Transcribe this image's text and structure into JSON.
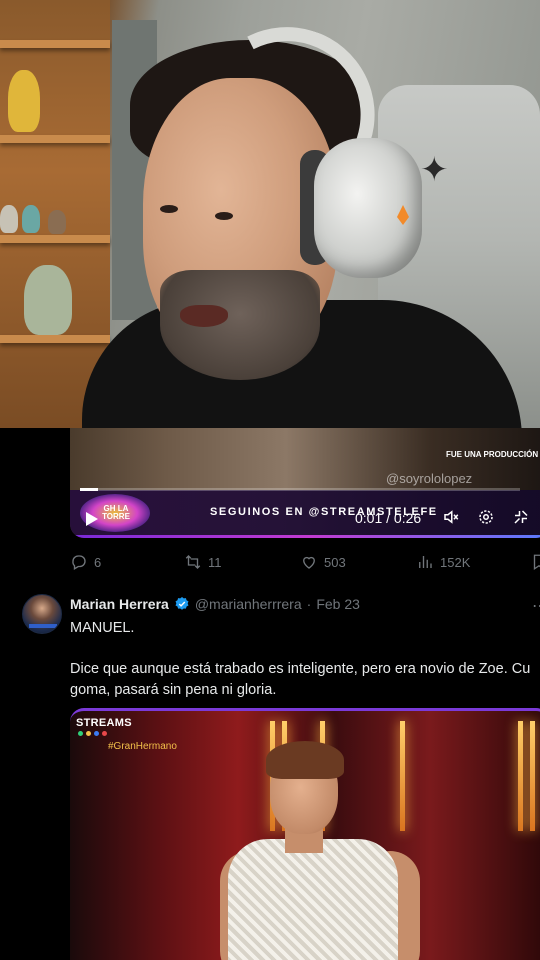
{
  "webcam": {
    "description_icon": "person-webcam-feed"
  },
  "top_video": {
    "fue_text": "FUE UNA PRODUCCIÓN",
    "watermark_handle": "@soyrololopez",
    "show_logo_text": "GH LA TORRE",
    "promo_text": "SEGUINOS EN @STREAMSTELEFE",
    "time": "0:01 / 0:26",
    "progress": 0.04,
    "controls": [
      "mute-icon",
      "settings-icon",
      "fullscreen-exit-icon"
    ]
  },
  "actions": {
    "replies": "6",
    "reposts": "11",
    "likes": "503",
    "views": "152K"
  },
  "tweet": {
    "display_name": "Marian Herrera",
    "handle": "@marianherrrera",
    "separator": "·",
    "date": "Feb 23",
    "line1": "MANUEL.",
    "line2": "Dice que aunque está trabado es inteligente, pero era novio de Zoe. Cu",
    "line3": "goma, pasará sin pena ni gloria.",
    "verified_color": "#1d9bf0"
  },
  "media": {
    "badge": "STREAMS",
    "hashtag": "#GranHermano",
    "dot_colors": [
      "#2fd07a",
      "#f2c04a",
      "#3b7bf2",
      "#e8484a"
    ]
  },
  "colors": {
    "background": "#000000",
    "text_primary": "#e7e9ea",
    "text_secondary": "#71767b",
    "accent_purple": "#7b3ad8"
  }
}
